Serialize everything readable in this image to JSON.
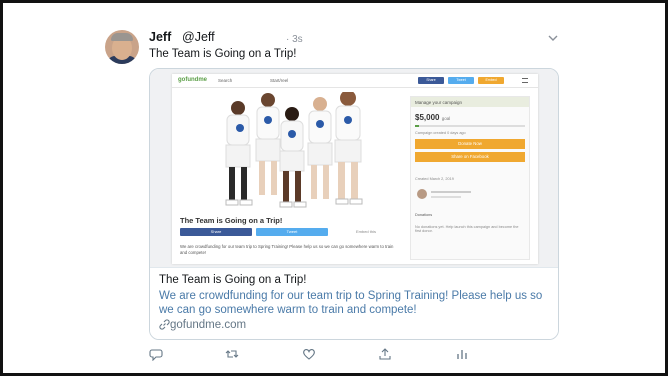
{
  "tweet": {
    "name": "Jeff",
    "handle": "@Jeff",
    "time": "· 3s",
    "text": "The Team is Going on a Trip!"
  },
  "card": {
    "preview": {
      "logo": "gofundme",
      "search": "Search",
      "start": "Start/reel",
      "header_buttons": [
        {
          "label": "Share",
          "color": "#3b5998"
        },
        {
          "label": "Tweet",
          "color": "#55acee"
        },
        {
          "label": "Embed",
          "color": "#f0a830"
        }
      ],
      "campaign_title": "The Team is Going on a Trip!",
      "share_facebook": "Share",
      "share_tweet": "Tweet",
      "embed_link": "Embed this",
      "description": "We are crowdfunding for our team trip to Spring Training! Please help us so we can go somewhere warm to train and compete!",
      "manage": "Manage your campaign",
      "goal_amount": "$5,000",
      "goal_word": "goal",
      "campaign_created": "Campaign created 0 days ago",
      "donate_label": "Donate Now",
      "share_facebook_btn": "Share on Facebook",
      "created_date": "Created March 2, 2019",
      "donations_heading": "Donations",
      "no_donations": "No donations yet. Help launch this campaign and become the first donor."
    },
    "title": "The Team is Going on a Trip!",
    "description": "We are crowdfunding for our team trip to Spring Training!  Please help us so we can go somewhere warm to train and compete!",
    "link": "gofundme.com"
  },
  "icons": {
    "reply": "reply-icon",
    "retweet": "retweet-icon",
    "like": "like-icon",
    "share": "share-icon",
    "analytics": "analytics-icon"
  }
}
